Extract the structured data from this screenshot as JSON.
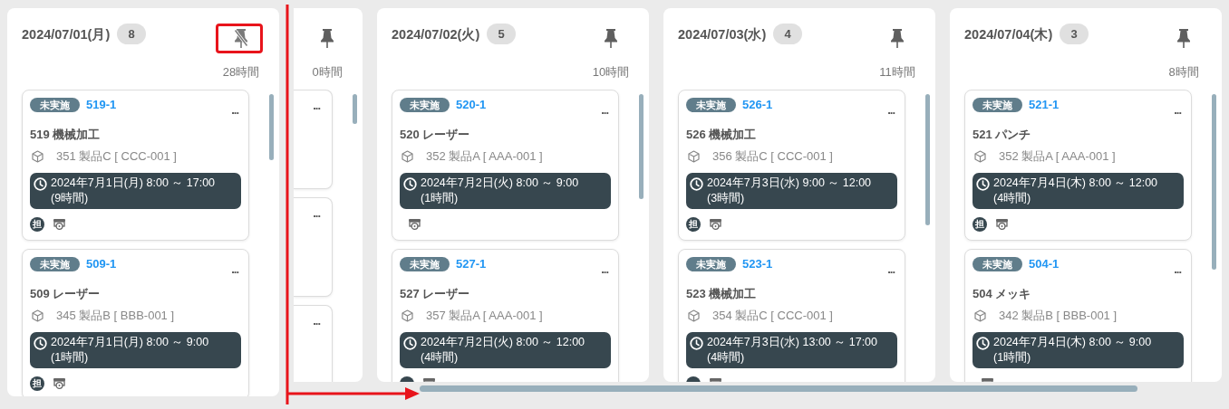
{
  "columns": [
    {
      "kind": "full",
      "date": "2024/07/01(月)",
      "count": "8",
      "pinned": true,
      "highlighted": true,
      "hours": "28時間",
      "cards": [
        {
          "status": "未実施",
          "id": "519-1",
          "menu": "...",
          "title": "519 機械加工",
          "product": "351 製品C [ CCC-001 ]",
          "time": "2024年7月1日(月) 8:00 ～ 17:00",
          "duration": "(9時間)",
          "tags": [
            {
              "kind": "assignee",
              "text": "担"
            },
            {
              "kind": "machine"
            }
          ]
        },
        {
          "status": "未実施",
          "id": "509-1",
          "menu": "...",
          "title": "509 レーザー",
          "product": "345 製品B [ BBB-001 ]",
          "time": "2024年7月1日(月) 8:00 ～ 9:00",
          "duration": "(1時間)",
          "tags": [
            {
              "kind": "assignee",
              "text": "担"
            },
            {
              "kind": "machine"
            }
          ]
        }
      ]
    },
    {
      "kind": "partial",
      "pinned": false,
      "hours": "0時間",
      "cards": [
        {
          "menu": "..."
        },
        {
          "menu": "..."
        },
        {
          "menu": "..."
        }
      ]
    },
    {
      "kind": "full",
      "date": "2024/07/02(火)",
      "count": "5",
      "pinned": false,
      "hours": "10時間",
      "cards": [
        {
          "status": "未実施",
          "id": "520-1",
          "menu": "...",
          "title": "520 レーザー",
          "product": "352 製品A [ AAA-001 ]",
          "time": "2024年7月2日(火) 8:00 ～ 9:00",
          "duration": "(1時間)",
          "tags": [
            {
              "kind": "machine"
            }
          ]
        },
        {
          "status": "未実施",
          "id": "527-1",
          "menu": "...",
          "title": "527 レーザー",
          "product": "357 製品A [ AAA-001 ]",
          "time": "2024年7月2日(火) 8:00 ～ 12:00",
          "duration": "(4時間)",
          "tags": [
            {
              "kind": "assignee"
            },
            {
              "kind": "machine"
            }
          ]
        }
      ]
    },
    {
      "kind": "full",
      "date": "2024/07/03(水)",
      "count": "4",
      "pinned": false,
      "hours": "11時間",
      "cards": [
        {
          "status": "未実施",
          "id": "526-1",
          "menu": "...",
          "title": "526 機械加工",
          "product": "356 製品C [ CCC-001 ]",
          "time": "2024年7月3日(水) 9:00 ～ 12:00",
          "duration": "(3時間)",
          "tags": [
            {
              "kind": "assignee",
              "text": "担"
            },
            {
              "kind": "machine"
            }
          ]
        },
        {
          "status": "未実施",
          "id": "523-1",
          "menu": "...",
          "title": "523 機械加工",
          "product": "354 製品C [ CCC-001 ]",
          "time": "2024年7月3日(水) 13:00 ～ 17:00",
          "duration": "(4時間)",
          "tags": [
            {
              "kind": "assignee"
            },
            {
              "kind": "machine"
            }
          ]
        }
      ]
    },
    {
      "kind": "full",
      "date": "2024/07/04(木)",
      "count": "3",
      "pinned": false,
      "hours": "8時間",
      "cards": [
        {
          "status": "未実施",
          "id": "521-1",
          "menu": "...",
          "title": "521 パンチ",
          "product": "352 製品A [ AAA-001 ]",
          "time": "2024年7月4日(木) 8:00 ～ 12:00",
          "duration": "(4時間)",
          "tags": [
            {
              "kind": "assignee",
              "text": "担"
            },
            {
              "kind": "machine"
            }
          ]
        },
        {
          "status": "未実施",
          "id": "504-1",
          "menu": "...",
          "title": "504 メッキ",
          "product": "342 製品B [ BBB-001 ]",
          "time": "2024年7月4日(木) 8:00 ～ 9:00",
          "duration": "(1時間)",
          "tags": [
            {
              "kind": "machine"
            }
          ]
        }
      ]
    }
  ],
  "scroll_arrow": true
}
